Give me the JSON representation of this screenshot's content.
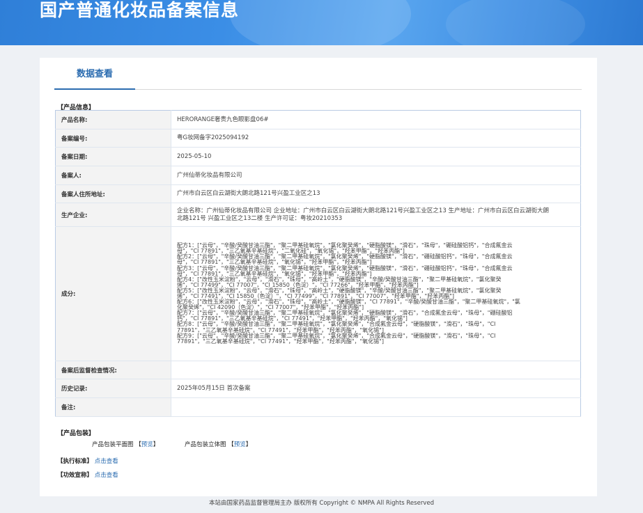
{
  "header": {
    "title": "国产普通化妆品备案信息"
  },
  "tabs": [
    {
      "label": "数据查看"
    }
  ],
  "sections": {
    "product_info": "【产品信息】",
    "packaging": "【产品包装】",
    "standard": "【执行标准】",
    "efficacy": "【功效宣称】"
  },
  "rows": {
    "name": {
      "label": "产品名称:",
      "value": "HERORANGE奢贵九色眼影盘06#"
    },
    "record_no": {
      "label": "备案编号:",
      "value": "粤G妆网备字2025094192"
    },
    "record_date": {
      "label": "备案日期:",
      "value": "2025-05-10"
    },
    "registrant": {
      "label": "备案人:",
      "value": "广州仙蒂化妆品有限公司"
    },
    "address": {
      "label": "备案人住所地址:",
      "value": "广州市白云区白云湖街大朗北路121号兴盈工业区之13"
    },
    "manufacturer": {
      "label": "生产企业:",
      "value": "企业名称：广州仙蒂化妆品有限公司 企业地址：广州市白云区白云湖街大朗北路121号兴盈工业区之13 生产地址：广州市白云区白云湖街大朗北路121号 兴盈工业区之13二楼 生产许可证：粤妆20210353"
    },
    "ingredients": {
      "label": "成分:"
    },
    "inspection": {
      "label": "备案后监督检查情况:",
      "value": ""
    },
    "history": {
      "label": "历史记录:",
      "value": "2025年05月15日 首次备案"
    },
    "remarks": {
      "label": "备注:",
      "value": ""
    }
  },
  "ingredient_lines": [
    "配方1：[\"云母\"，\"辛酸/癸酸甘油三酯\"，\"聚二甲基硅氧烷\"，\"氯化聚癸烯\"，\"硬脂酸镁\"，\"滑石\"，\"珠母\"，\"硼硅酸铝钙\"，\"合成氟金云",
    "母\"，\"CI 77891\"，\"三乙氧基辛基硅烷\"，\"二氧化硅\"，\"氧化锡\"，\"羟苯甲酯\"，\"羟苯丙酯\"]",
    "配方2：[\"云母\"，\"辛酸/癸酸甘油三酯\"，\"聚二甲基硅氧烷\"，\"氯化聚癸烯\"，\"硬脂酸镁\"，\"滑石\"，\"硼硅酸铝钙\"，\"珠母\"，\"合成氟金云",
    "母\"，\"CI 77891\"，\"三乙氧基辛基硅烷\"，\"氧化锡\"，\"羟苯甲酯\"，\"羟苯丙酯\"]",
    "配方3：[\"云母\"，\"辛酸/癸酸甘油三酯\"，\"聚二甲基硅氧烷\"，\"氯化聚癸烯\"，\"硬脂酸镁\"，\"滑石\"，\"硼硅酸铝钙\"，\"珠母\"，\"合成氟金云",
    "母\"，\"CI 77891\"，\"三乙氧基辛基硅烷\"，\"氧化锡\"，\"羟苯甲酯\"，\"羟苯丙酯\"]",
    "配方4：[\"改性玉米淀粉\"，\"云母\"，\"滑石\"，\"珠母\"，\"高岭土\"，\"硬脂酸镁\"，\"辛酸/癸酸甘油三酯\"，\"聚二甲基硅氧烷\"，\"氯化聚癸",
    "烯\"，\"CI 77499\"，\"CI 77007\"，\"CI 15850（色淀）\"，\"CI 77266\"，\"羟苯甲酯\"，\"羟苯丙酯\"]",
    "配方5：[\"改性玉米淀粉\"，\"云母\"，\"滑石\"，\"珠母\"，\"高岭土\"，\"硬脂酸镁\"，\"辛酸/癸酸甘油三酯\"，\"聚二甲基硅氧烷\"，\"氯化聚癸",
    "烯\"，\"CI 77491\"，\"CI 15850（色淀）\"，\"CI 77499\"，\"CI 77891\"，\"CI 77007\"，\"羟苯甲酯\"，\"羟苯丙酯\"]",
    "配方6：[\"改性玉米淀粉\"，\"云母\"，\"滑石\"，\"珠母\"，\"高岭土\"，\"硬脂酸镁\"，\"CI 77891\"，\"辛酸/癸酸甘油三酯\"，\"聚二甲基硅氧烷\"，\"氯",
    "化聚癸烯\"，\"CI 42090（色淀）\"，\"CI 77007\"，\"羟苯甲酯\"，\"羟苯丙酯\"]",
    "配方7：[\"云母\"，\"辛酸/癸酸甘油三酯\"，\"聚二甲基硅氧烷\"，\"氯化聚癸烯\"，\"硬脂酸镁\"，\"滑石\"，\"合成氟金云母\"，\"珠母\"，\"硼硅酸铝",
    "钙\"，\"CI 77891\"，\"三乙氧基辛基硅烷\"，\"CI 77491\"，\"羟苯甲酯\"，\"羟苯丙酯\"，\"氧化锡\"]",
    "配方8：[\"云母\"，\"辛酸/癸酸甘油三酯\"，\"聚二甲基硅氧烷\"，\"氯化聚癸烯\"，\"合成氟金云母\"，\"硬脂酸镁\"，\"滑石\"，\"珠母\"，\"CI",
    "77891\"，\"三乙氧基辛基硅烷\"，\"CI 77491\"，\"羟苯甲酯\"，\"羟苯丙酯\"，\"氧化锡\"]",
    "配方9：[\"云母\"，\"辛酸/癸酸甘油三酯\"，\"聚二甲基硅氧烷\"，\"氯化聚癸烯\"，\"合成氟金云母\"，\"硬脂酸镁\"，\"滑石\"，\"珠母\"，\"CI",
    "77891\"，\"三乙氧基辛基硅烷\"，\"CI 77491\"，\"羟苯甲酯\"，\"羟苯丙酯\"，\"氧化锡\"]"
  ],
  "packaging": {
    "flat_label": "产品包装平面图",
    "stereo_label": "产品包装立体图",
    "bracket_open": "【",
    "bracket_close": "】",
    "preview": "预览"
  },
  "links": {
    "view": "点击查看"
  },
  "footer": {
    "text": "本站由国家药品监督管理局主办 版权所有 Copyright © NMPA All Rights Reserved"
  },
  "colors": {
    "banner": "#3b8ee6",
    "link": "#2b6cb0",
    "border": "#b9cbe4"
  }
}
